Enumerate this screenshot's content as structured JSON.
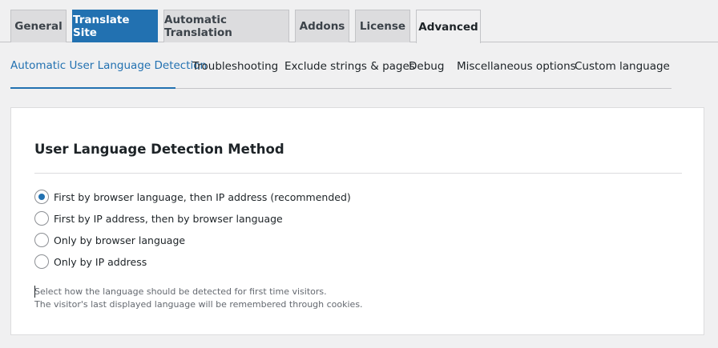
{
  "top_tabs": [
    {
      "label": "General"
    },
    {
      "label": "Translate Site"
    },
    {
      "label": "Automatic Translation"
    },
    {
      "label": "Addons"
    },
    {
      "label": "License"
    },
    {
      "label": "Advanced"
    }
  ],
  "sub_tabs": [
    {
      "label": "Automatic User Language Detection"
    },
    {
      "label": "Troubleshooting"
    },
    {
      "label": "Exclude strings & pages"
    },
    {
      "label": "Debug"
    },
    {
      "label": "Miscellaneous options"
    },
    {
      "label": "Custom language"
    }
  ],
  "panel": {
    "title": "User Language Detection Method",
    "options": [
      {
        "label": "First by browser language, then IP address (recommended)",
        "checked": true
      },
      {
        "label": "First by IP address, then by browser language",
        "checked": false
      },
      {
        "label": "Only by browser language",
        "checked": false
      },
      {
        "label": "Only by IP address",
        "checked": false
      }
    ],
    "description_line1": "Select how the language should be detected for first time visitors.",
    "description_line2": "The visitor's last displayed language will be remembered through cookies."
  },
  "colors": {
    "accent": "#2271b1",
    "background": "#f0f0f1",
    "panel": "#ffffff"
  }
}
